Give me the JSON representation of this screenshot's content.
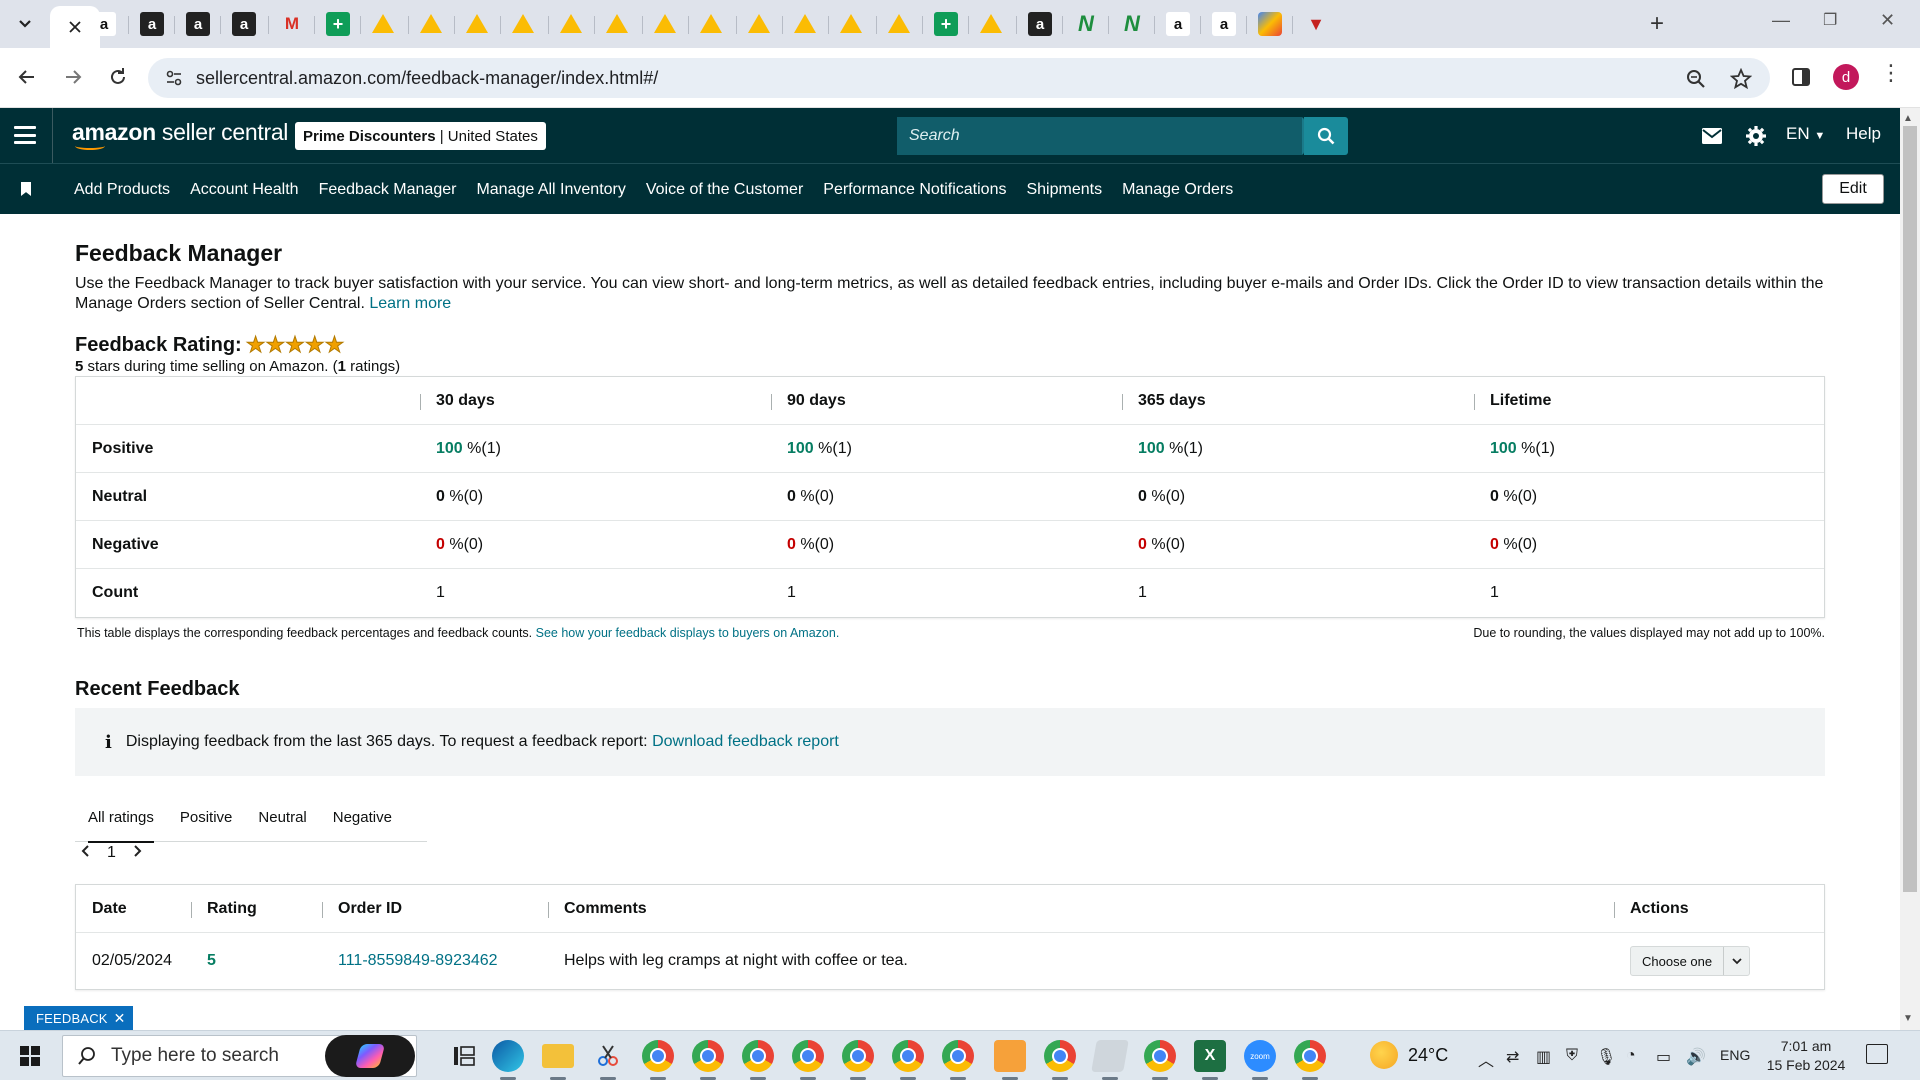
{
  "browser": {
    "active_tab_icon": "close-icon",
    "url": "sellercentral.amazon.com/feedback-manager/index.html#/",
    "profile_initial": "d"
  },
  "header": {
    "logo_text_bold": "amazon",
    "logo_text": " seller central",
    "store_name": "Prime Discounters",
    "store_separator": " | ",
    "store_region": "United States",
    "search_placeholder": "Search",
    "language": "EN",
    "help": "Help"
  },
  "nav": {
    "items": [
      {
        "label": "Add Products"
      },
      {
        "label": "Account Health"
      },
      {
        "label": "Feedback Manager"
      },
      {
        "label": "Manage All Inventory"
      },
      {
        "label": "Voice of the Customer"
      },
      {
        "label": "Performance Notifications"
      },
      {
        "label": "Shipments"
      },
      {
        "label": "Manage Orders"
      }
    ],
    "edit_label": "Edit"
  },
  "page": {
    "title": "Feedback Manager",
    "intro": "Use the Feedback Manager to track buyer satisfaction with your service. You can view short- and long-term metrics, as well as detailed feedback entries, including buyer e-mails and Order IDs. Click the Order ID to view transaction details within the Manage Orders section of Seller Central.",
    "learn_more": "Learn more",
    "rating_label": "Feedback Rating:",
    "rating_stars": 5,
    "rating_sub_stars": "5",
    "rating_sub_mid": " stars during time selling on Amazon. (",
    "rating_sub_count": "1",
    "rating_sub_end": " ratings)"
  },
  "metrics": {
    "columns": [
      "30 days",
      "90 days",
      "365 days",
      "Lifetime"
    ],
    "rows": [
      {
        "label": "Positive",
        "kind": "pos",
        "cells": [
          {
            "pct": "100",
            "rest": " %(1)"
          },
          {
            "pct": "100",
            "rest": " %(1)"
          },
          {
            "pct": "100",
            "rest": " %(1)"
          },
          {
            "pct": "100",
            "rest": " %(1)"
          }
        ]
      },
      {
        "label": "Neutral",
        "kind": "neu",
        "cells": [
          {
            "pct": "0",
            "rest": " %(0)"
          },
          {
            "pct": "0",
            "rest": " %(0)"
          },
          {
            "pct": "0",
            "rest": " %(0)"
          },
          {
            "pct": "0",
            "rest": " %(0)"
          }
        ]
      },
      {
        "label": "Negative",
        "kind": "neg",
        "cells": [
          {
            "pct": "0",
            "rest": " %(0)"
          },
          {
            "pct": "0",
            "rest": " %(0)"
          },
          {
            "pct": "0",
            "rest": " %(0)"
          },
          {
            "pct": "0",
            "rest": " %(0)"
          }
        ]
      },
      {
        "label": "Count",
        "kind": "count",
        "cells": [
          {
            "pct": "",
            "rest": "1"
          },
          {
            "pct": "",
            "rest": "1"
          },
          {
            "pct": "",
            "rest": "1"
          },
          {
            "pct": "",
            "rest": "1"
          }
        ]
      }
    ],
    "note_left": "This table displays the corresponding feedback percentages and feedback counts.",
    "note_link": "See how your feedback displays to buyers on Amazon.",
    "note_right": "Due to rounding, the values displayed may not add up to 100%."
  },
  "recent": {
    "title": "Recent Feedback",
    "info_text": "Displaying feedback from the last 365 days. To request a feedback report:",
    "info_link": "Download feedback report",
    "tabs": [
      "All ratings",
      "Positive",
      "Neutral",
      "Negative"
    ],
    "page": "1",
    "columns": {
      "date": "Date",
      "rating": "Rating",
      "order": "Order ID",
      "comments": "Comments",
      "actions": "Actions"
    },
    "rows": [
      {
        "date": "02/05/2024",
        "rating": "5",
        "order_id": "111-8559849-8923462",
        "comment": "Helps with leg cramps at night with coffee or tea.",
        "action": "Choose one"
      }
    ]
  },
  "feedback_tab": "FEEDBACK",
  "taskbar": {
    "search_placeholder": "Type here to search",
    "weather": "24°C",
    "language": "ENG",
    "time": "7:01 am",
    "date": "15 Feb 2024"
  },
  "colors": {
    "header_bg": "#002f36",
    "link": "#007185",
    "positive": "#067d62",
    "negative": "#c40000",
    "star": "#f0a000"
  }
}
